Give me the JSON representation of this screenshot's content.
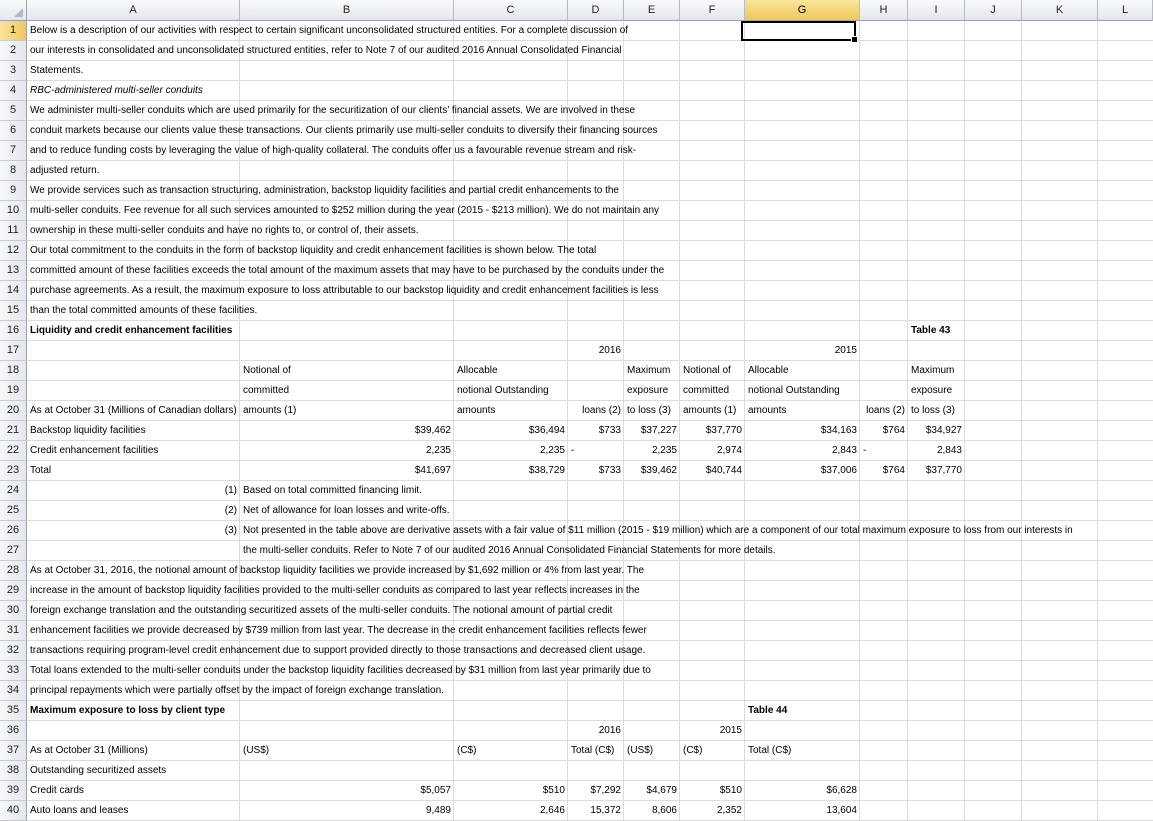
{
  "columns": [
    {
      "id": "A",
      "w": 213
    },
    {
      "id": "B",
      "w": 214
    },
    {
      "id": "C",
      "w": 114
    },
    {
      "id": "D",
      "w": 56
    },
    {
      "id": "E",
      "w": 56
    },
    {
      "id": "F",
      "w": 65
    },
    {
      "id": "G",
      "w": 115
    },
    {
      "id": "H",
      "w": 48
    },
    {
      "id": "I",
      "w": 57
    },
    {
      "id": "J",
      "w": 57
    },
    {
      "id": "K",
      "w": 76
    },
    {
      "id": "L",
      "w": 76
    }
  ],
  "selected_cell": {
    "col": "G",
    "row": "1"
  },
  "rows": [
    {
      "n": "1",
      "cells": [
        {
          "c": "A",
          "t": "Below is a description of our activities with respect to certain significant unconsolidated structured entities. For a complete discussion of",
          "s": ""
        }
      ]
    },
    {
      "n": "2",
      "cells": [
        {
          "c": "A",
          "t": "our interests in consolidated and unconsolidated structured entities, refer to Note 7 of our audited 2016 Annual Consolidated Financial",
          "s": ""
        }
      ]
    },
    {
      "n": "3",
      "cells": [
        {
          "c": "A",
          "t": "Statements.",
          "s": ""
        }
      ]
    },
    {
      "n": "4",
      "cells": [
        {
          "c": "A",
          "t": "RBC-administered multi-seller conduits",
          "s": "i"
        }
      ]
    },
    {
      "n": "5",
      "cells": [
        {
          "c": "A",
          "t": "We administer multi-seller conduits which are used primarily for the securitization of our clients’ financial assets. We are involved in these",
          "s": ""
        }
      ]
    },
    {
      "n": "6",
      "cells": [
        {
          "c": "A",
          "t": "conduit markets because our clients value these transactions. Our clients primarily use multi-seller conduits to diversify their financing sources",
          "s": ""
        }
      ]
    },
    {
      "n": "7",
      "cells": [
        {
          "c": "A",
          "t": "and to reduce funding costs by leveraging the value of high-quality collateral. The conduits offer us a favourable revenue stream and risk-",
          "s": ""
        }
      ]
    },
    {
      "n": "8",
      "cells": [
        {
          "c": "A",
          "t": "adjusted return.",
          "s": ""
        }
      ]
    },
    {
      "n": "9",
      "cells": [
        {
          "c": "A",
          "t": "We provide services such as transaction structuring, administration, backstop liquidity facilities and partial credit enhancements to the",
          "s": ""
        }
      ]
    },
    {
      "n": "10",
      "cells": [
        {
          "c": "A",
          "t": "multi-seller conduits. Fee revenue for all such services amounted to $252 million during the year (2015 - $213 million). We do not maintain any",
          "s": ""
        }
      ]
    },
    {
      "n": "11",
      "cells": [
        {
          "c": "A",
          "t": "ownership in these multi-seller conduits and have no rights to, or control of, their assets.",
          "s": ""
        }
      ]
    },
    {
      "n": "12",
      "cells": [
        {
          "c": "A",
          "t": "Our total commitment to the conduits in the form of backstop liquidity and credit enhancement facilities is shown below. The total",
          "s": ""
        }
      ]
    },
    {
      "n": "13",
      "cells": [
        {
          "c": "A",
          "t": "committed amount of these facilities exceeds the total amount of the maximum assets that may have to be purchased by the conduits under the",
          "s": ""
        }
      ]
    },
    {
      "n": "14",
      "cells": [
        {
          "c": "A",
          "t": "purchase agreements. As a result, the maximum exposure to loss attributable to our backstop liquidity and credit enhancement facilities is less",
          "s": ""
        }
      ]
    },
    {
      "n": "15",
      "cells": [
        {
          "c": "A",
          "t": "than the total committed amounts of these facilities.",
          "s": ""
        }
      ]
    },
    {
      "n": "16",
      "cells": [
        {
          "c": "A",
          "t": "Liquidity and credit enhancement facilities",
          "s": "b"
        },
        {
          "c": "I",
          "t": "Table 43",
          "s": "b"
        }
      ]
    },
    {
      "n": "17",
      "cells": [
        {
          "c": "C",
          "t": "2016",
          "s": "r span2"
        },
        {
          "c": "G",
          "t": "2015",
          "s": "r"
        }
      ]
    },
    {
      "n": "18",
      "cells": [
        {
          "c": "B",
          "t": "Notional of",
          "s": ""
        },
        {
          "c": "C",
          "t": "Allocable",
          "s": ""
        },
        {
          "c": "E",
          "t": "Maximum",
          "s": ""
        },
        {
          "c": "F",
          "t": "Notional of",
          "s": ""
        },
        {
          "c": "G",
          "t": "Allocable",
          "s": ""
        },
        {
          "c": "I",
          "t": "Maximum",
          "s": ""
        }
      ]
    },
    {
      "n": "19",
      "cells": [
        {
          "c": "B",
          "t": "committed",
          "s": ""
        },
        {
          "c": "C",
          "t": "notional  Outstanding",
          "s": ""
        },
        {
          "c": "E",
          "t": "exposure",
          "s": ""
        },
        {
          "c": "F",
          "t": "committed",
          "s": ""
        },
        {
          "c": "G",
          "t": "notional  Outstanding",
          "s": ""
        },
        {
          "c": "I",
          "t": "exposure",
          "s": ""
        }
      ]
    },
    {
      "n": "20",
      "cells": [
        {
          "c": "A",
          "t": "As at October 31 (Millions of Canadian dollars)",
          "s": "clip"
        },
        {
          "c": "B",
          "t": "amounts (1)",
          "s": ""
        },
        {
          "c": "C",
          "t": "amounts",
          "s": ""
        },
        {
          "c": "D",
          "t": "loans (2)",
          "s": "r"
        },
        {
          "c": "E",
          "t": "to loss (3)",
          "s": ""
        },
        {
          "c": "F",
          "t": "amounts (1)",
          "s": ""
        },
        {
          "c": "G",
          "t": "amounts",
          "s": ""
        },
        {
          "c": "H",
          "t": "loans (2)",
          "s": "r"
        },
        {
          "c": "I",
          "t": "to loss (3)",
          "s": ""
        }
      ]
    },
    {
      "n": "21",
      "cells": [
        {
          "c": "A",
          "t": "Backstop liquidity facilities",
          "s": ""
        },
        {
          "c": "B",
          "t": "$39,462",
          "s": "r"
        },
        {
          "c": "C",
          "t": "$36,494",
          "s": "r"
        },
        {
          "c": "D",
          "t": "$733",
          "s": "r"
        },
        {
          "c": "E",
          "t": "$37,227",
          "s": "r"
        },
        {
          "c": "F",
          "t": "$37,770",
          "s": "r"
        },
        {
          "c": "G",
          "t": "$34,163",
          "s": "r"
        },
        {
          "c": "H",
          "t": "$764",
          "s": "r"
        },
        {
          "c": "I",
          "t": "$34,927",
          "s": "r"
        }
      ]
    },
    {
      "n": "22",
      "cells": [
        {
          "c": "A",
          "t": "Credit enhancement facilities",
          "s": ""
        },
        {
          "c": "B",
          "t": "2,235",
          "s": "r"
        },
        {
          "c": "C",
          "t": "2,235",
          "s": "r"
        },
        {
          "c": "D",
          "t": "-",
          "s": ""
        },
        {
          "c": "E",
          "t": "2,235",
          "s": "r"
        },
        {
          "c": "F",
          "t": "2,974",
          "s": "r"
        },
        {
          "c": "G",
          "t": "2,843",
          "s": "r"
        },
        {
          "c": "H",
          "t": "-",
          "s": ""
        },
        {
          "c": "I",
          "t": "2,843",
          "s": "r"
        }
      ]
    },
    {
      "n": "23",
      "cells": [
        {
          "c": "A",
          "t": "Total",
          "s": ""
        },
        {
          "c": "B",
          "t": "$41,697",
          "s": "r"
        },
        {
          "c": "C",
          "t": "$38,729",
          "s": "r"
        },
        {
          "c": "D",
          "t": "$733",
          "s": "r"
        },
        {
          "c": "E",
          "t": "$39,462",
          "s": "r"
        },
        {
          "c": "F",
          "t": "$40,744",
          "s": "r"
        },
        {
          "c": "G",
          "t": "$37,006",
          "s": "r"
        },
        {
          "c": "H",
          "t": "$764",
          "s": "r"
        },
        {
          "c": "I",
          "t": "$37,770",
          "s": "r"
        }
      ]
    },
    {
      "n": "24",
      "cells": [
        {
          "c": "A",
          "t": "(1)",
          "s": "r"
        },
        {
          "c": "B",
          "t": "Based on total committed financing limit.",
          "s": ""
        }
      ]
    },
    {
      "n": "25",
      "cells": [
        {
          "c": "A",
          "t": "(2)",
          "s": "r"
        },
        {
          "c": "B",
          "t": "Net of allowance for loan losses and write-offs.",
          "s": ""
        }
      ]
    },
    {
      "n": "26",
      "cells": [
        {
          "c": "A",
          "t": "(3)",
          "s": "r"
        },
        {
          "c": "B",
          "t": "Not presented in the table above are derivative assets with a fair value of $11 million (2015 - $19 million) which are a component of our total maximum exposure to loss from our interests in",
          "s": ""
        }
      ]
    },
    {
      "n": "27",
      "cells": [
        {
          "c": "B",
          "t": "the multi-seller conduits. Refer to Note 7 of our audited 2016 Annual Consolidated Financial Statements for more details.",
          "s": ""
        }
      ]
    },
    {
      "n": "28",
      "cells": [
        {
          "c": "A",
          "t": "As at October 31, 2016, the notional amount of backstop liquidity facilities we provide increased by $1,692 million or 4% from last year. The",
          "s": ""
        }
      ]
    },
    {
      "n": "29",
      "cells": [
        {
          "c": "A",
          "t": "increase in the amount of backstop liquidity facilities provided to the multi-seller conduits as compared to last year reflects increases in the",
          "s": ""
        }
      ]
    },
    {
      "n": "30",
      "cells": [
        {
          "c": "A",
          "t": "foreign exchange translation and the outstanding securitized assets of the multi-seller conduits. The notional amount of partial credit",
          "s": ""
        }
      ]
    },
    {
      "n": "31",
      "cells": [
        {
          "c": "A",
          "t": "enhancement facilities we provide decreased by $739 million from last year. The decrease in the credit enhancement facilities reflects fewer",
          "s": ""
        }
      ]
    },
    {
      "n": "32",
      "cells": [
        {
          "c": "A",
          "t": "transactions requiring program-level credit enhancement due to support provided directly to those transactions and decreased client usage.",
          "s": ""
        }
      ]
    },
    {
      "n": "33",
      "cells": [
        {
          "c": "A",
          "t": "Total loans extended to the multi-seller conduits under the backstop liquidity facilities decreased by $31 million from last year primarily due to",
          "s": ""
        }
      ]
    },
    {
      "n": "34",
      "cells": [
        {
          "c": "A",
          "t": "principal repayments which were partially offset by the impact of foreign exchange translation.",
          "s": ""
        }
      ]
    },
    {
      "n": "35",
      "cells": [
        {
          "c": "A",
          "t": "Maximum exposure to loss by client type",
          "s": "b"
        },
        {
          "c": "G",
          "t": "Table 44",
          "s": "b"
        }
      ]
    },
    {
      "n": "36",
      "cells": [
        {
          "c": "C",
          "t": "2016",
          "s": "r span2"
        },
        {
          "c": "F",
          "t": "2015",
          "s": "r"
        }
      ]
    },
    {
      "n": "37",
      "cells": [
        {
          "c": "A",
          "t": "As at October 31 (Millions)",
          "s": ""
        },
        {
          "c": "B",
          "t": "(US$)",
          "s": ""
        },
        {
          "c": "C",
          "t": "(C$)",
          "s": ""
        },
        {
          "c": "D",
          "t": "Total (C$)",
          "s": ""
        },
        {
          "c": "E",
          "t": "(US$)",
          "s": ""
        },
        {
          "c": "F",
          "t": "(C$)",
          "s": ""
        },
        {
          "c": "G",
          "t": "Total (C$)",
          "s": ""
        }
      ]
    },
    {
      "n": "38",
      "cells": [
        {
          "c": "A",
          "t": "Outstanding securitized assets",
          "s": ""
        }
      ]
    },
    {
      "n": "39",
      "cells": [
        {
          "c": "A",
          "t": "Credit cards",
          "s": ""
        },
        {
          "c": "B",
          "t": "$5,057",
          "s": "r"
        },
        {
          "c": "C",
          "t": "$510",
          "s": "r"
        },
        {
          "c": "D",
          "t": "$7,292",
          "s": "r"
        },
        {
          "c": "E",
          "t": "$4,679",
          "s": "r"
        },
        {
          "c": "F",
          "t": "$510",
          "s": "r"
        },
        {
          "c": "G",
          "t": "$6,628",
          "s": "r"
        }
      ]
    },
    {
      "n": "40",
      "cells": [
        {
          "c": "A",
          "t": "Auto loans and leases",
          "s": ""
        },
        {
          "c": "B",
          "t": "9,489",
          "s": "r"
        },
        {
          "c": "C",
          "t": "2,646",
          "s": "r"
        },
        {
          "c": "D",
          "t": "15,372",
          "s": "r"
        },
        {
          "c": "E",
          "t": "8,606",
          "s": "r"
        },
        {
          "c": "F",
          "t": "2,352",
          "s": "r"
        },
        {
          "c": "G",
          "t": "13,604",
          "s": "r"
        }
      ]
    }
  ]
}
